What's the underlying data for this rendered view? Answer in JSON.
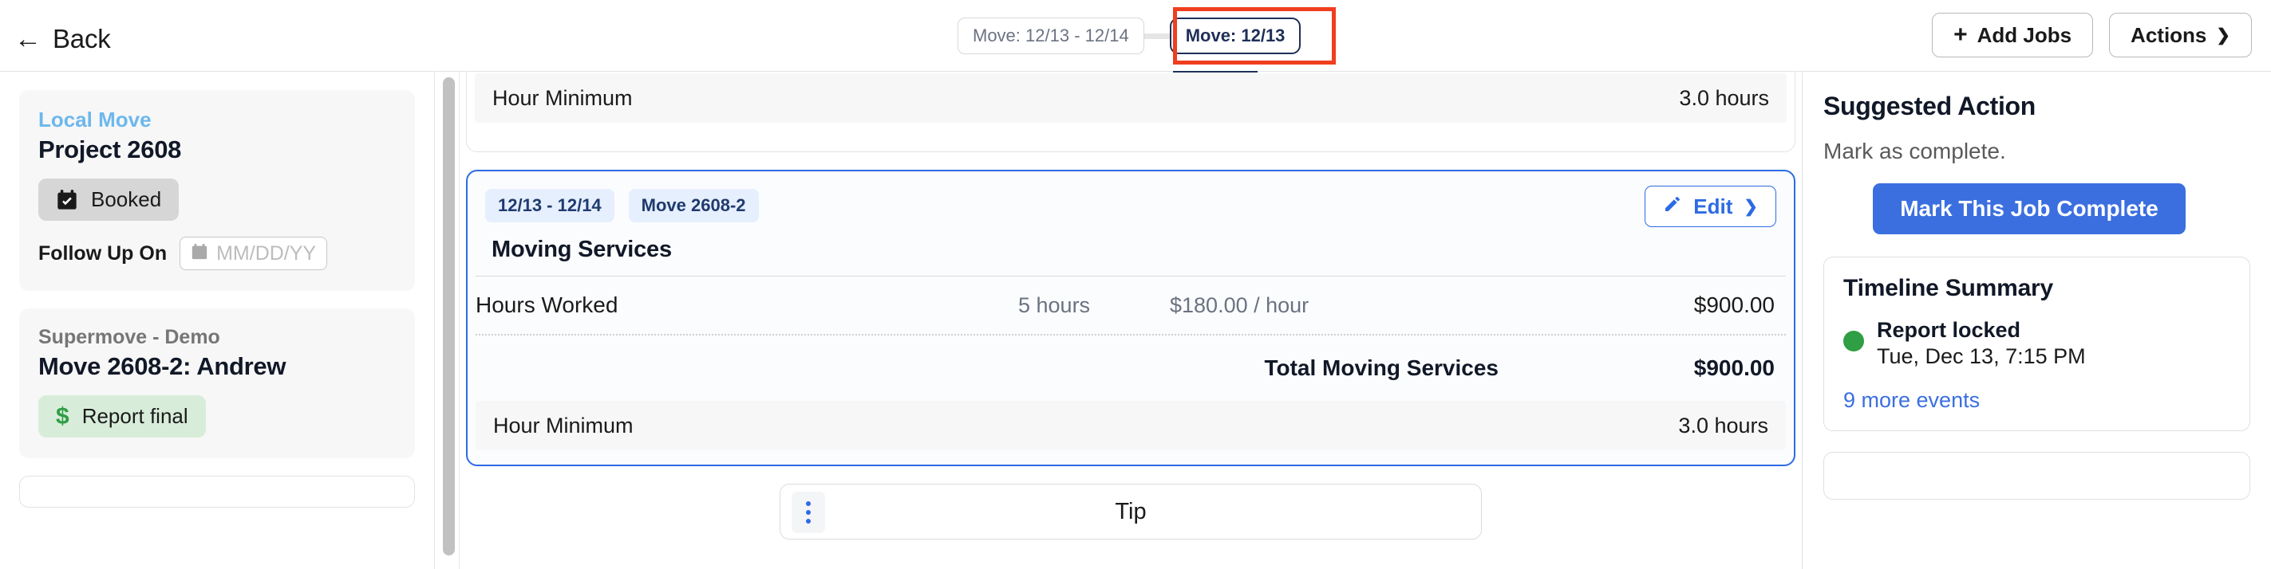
{
  "header": {
    "back_label": "Back",
    "back_icon": "arrow-left-icon",
    "breadcrumbs": [
      {
        "label": "Move: 12/13 - 12/14",
        "active": false
      },
      {
        "label": "Move: 12/13",
        "active": true
      }
    ],
    "add_jobs_label": "Add Jobs",
    "add_jobs_icon": "plus-icon",
    "actions_label": "Actions",
    "actions_icon": "chevron-down-icon"
  },
  "annotation": {
    "color": "#f03e1e"
  },
  "sidebar": {
    "project_card": {
      "eyebrow": "Local Move",
      "title": "Project 2608",
      "status_label": "Booked",
      "status_icon": "calendar-check-icon",
      "followup_label": "Follow Up On",
      "followup_placeholder": "MM/DD/YY",
      "followup_value": "",
      "followup_icon": "calendar-icon"
    },
    "move_card": {
      "eyebrow": "Supermove - Demo",
      "title": "Move 2608-2: Andrew",
      "status_label": "Report final",
      "status_icon": "dollar-icon"
    }
  },
  "main": {
    "partial_card": {
      "row_label": "Hour Minimum",
      "row_value": "3.0 hours"
    },
    "job_card": {
      "tags": [
        "12/13 - 12/14",
        "Move 2608-2"
      ],
      "edit_label": "Edit",
      "edit_icon": "pencil-icon",
      "edit_chevron": "chevron-down-icon",
      "section_title": "Moving Services",
      "line_items": [
        {
          "name": "Hours Worked",
          "quantity": "5 hours",
          "rate": "$180.00 / hour",
          "amount": "$900.00"
        }
      ],
      "total_label": "Total Moving Services",
      "total_amount": "$900.00",
      "minimum_label": "Hour Minimum",
      "minimum_value": "3.0 hours"
    },
    "tip_card": {
      "label": "Tip",
      "menu_icon": "kebab-menu-icon"
    }
  },
  "right_panel": {
    "suggested_title": "Suggested Action",
    "suggested_text": "Mark as complete.",
    "cta_label": "Mark This Job Complete",
    "timeline": {
      "title": "Timeline Summary",
      "events": [
        {
          "title": "Report locked",
          "time": "Tue, Dec 13, 7:15 PM",
          "status_color": "#2f9e44"
        }
      ],
      "more_link": "9 more events"
    }
  },
  "colors": {
    "accent_blue": "#2d6be4",
    "navy": "#1f2f58",
    "green": "#2f9e44",
    "annotation_red": "#f03e1e"
  }
}
